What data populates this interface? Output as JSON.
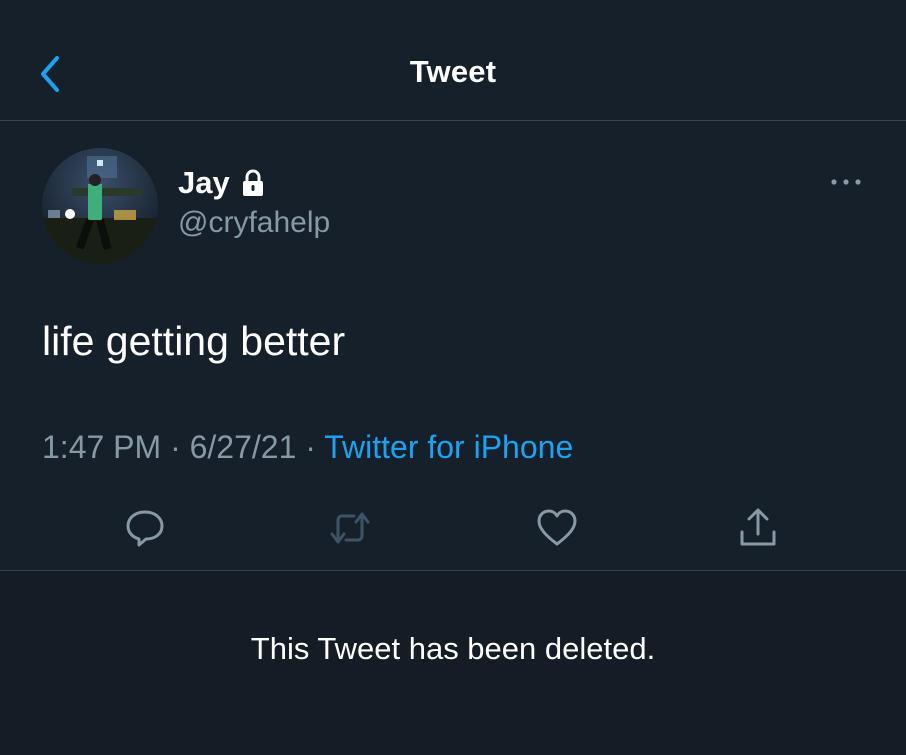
{
  "header": {
    "title": "Tweet",
    "back_icon": "chevron-left-icon"
  },
  "author": {
    "name": "Jay",
    "handle": "@cryfahelp",
    "protected_icon": "lock-icon",
    "avatar": "avatar-photo"
  },
  "tweet": {
    "text": "life getting better",
    "time": "1:47 PM",
    "separator": "·",
    "date": "6/27/21",
    "source": "Twitter for iPhone"
  },
  "actions": [
    "reply-icon",
    "retweet-icon",
    "like-icon",
    "share-icon"
  ],
  "notice": {
    "text": "This Tweet has been deleted."
  },
  "colors": {
    "background": "#15202b",
    "secondary_text": "#8899a6",
    "accent": "#1da1f2",
    "divider": "#38444d"
  }
}
